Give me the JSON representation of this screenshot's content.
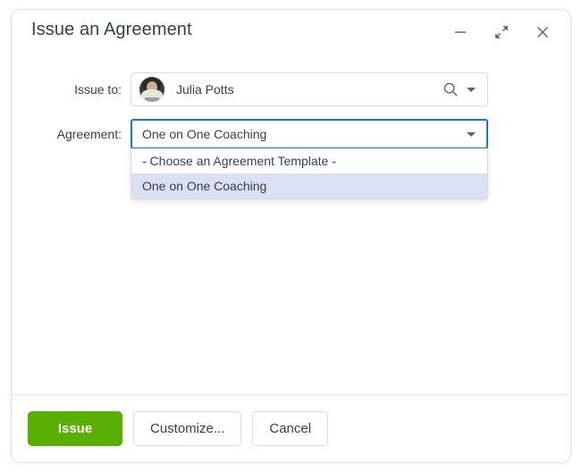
{
  "window": {
    "title": "Issue an Agreement",
    "controls": [
      {
        "name": "minimize-button",
        "icon": "minimize-icon",
        "label": "—"
      },
      {
        "name": "collapse-button",
        "icon": "collapse-diagonal-icon",
        "label": ""
      },
      {
        "name": "close-button",
        "icon": "close-icon",
        "label": "✕"
      }
    ]
  },
  "form": {
    "issue_to": {
      "label": "Issue to:",
      "value": "Julia Potts",
      "placeholder": "Issue to",
      "avatar_alt": "Julia Potts avatar",
      "search_icon": "search-icon",
      "dropdown_icon": "chevron-down-icon"
    },
    "agreement": {
      "label": "Agreement:",
      "selected": "One on One Coaching",
      "dropdown_icon": "chevron-down-icon",
      "expanded": true,
      "options": [
        {
          "label": "- Choose an Agreement Template -",
          "selected": false
        },
        {
          "label": "One on One Coaching",
          "selected": true
        }
      ]
    }
  },
  "footer": {
    "issue_label": "Issue",
    "customize_label": "Customize...",
    "cancel_label": "Cancel"
  },
  "colors": {
    "primary_green": "#58ae02",
    "focus_blue": "#1a73e8",
    "option_highlight": "#dae1f5",
    "text": "#3c4043",
    "border": "#dadce0"
  }
}
